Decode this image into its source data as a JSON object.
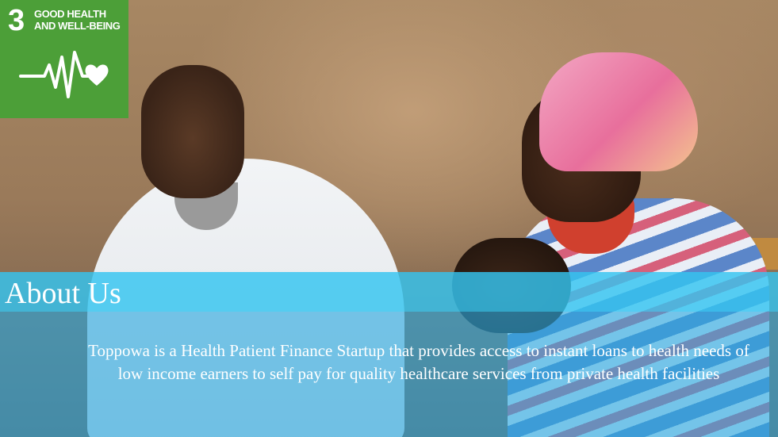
{
  "badge": {
    "number": "3",
    "title": "GOOD HEALTH AND WELL-BEING",
    "color": "#4c9f38",
    "icon": "heartbeat-heart-icon"
  },
  "about": {
    "heading": "About Us",
    "text": "Toppowa is a Health Patient Finance Startup that provides access to instant loans to health needs of low income earners to self pay for quality healthcare services from private health facilities",
    "band_color": "#34c4f0"
  },
  "photo": {
    "icon": "background-photo"
  }
}
